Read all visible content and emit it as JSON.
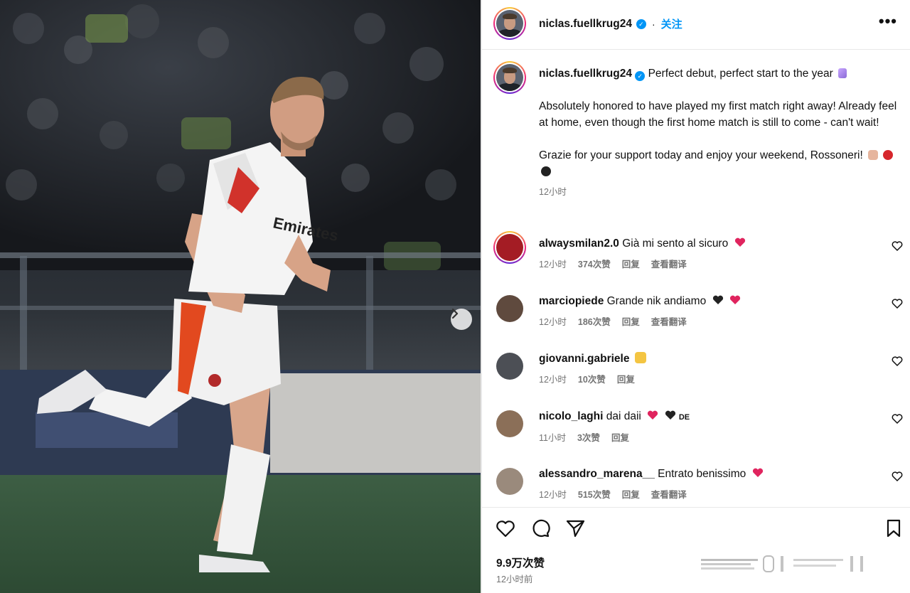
{
  "header": {
    "username": "niclas.fuellkrug24",
    "follow_label": "关注",
    "more_label": "•••"
  },
  "caption": {
    "username": "niclas.fuellkrug24",
    "line1": "Perfect debut, perfect start to the year",
    "para1": "Absolutely honored to have played my first match right away! Already feel at home, even though the first home match is still to come - can't wait!",
    "para2": "Grazie for your support today and enjoy your weekend, Rossoneri!",
    "time": "12小时"
  },
  "photo": {
    "jersey_sponsor": "Emirates"
  },
  "comments": [
    {
      "username": "alwaysmilan2.0",
      "text": "Già mi sento al sicuro",
      "time": "12小时",
      "likes": "374次赞",
      "reply": "回复",
      "translate": "查看翻译"
    },
    {
      "username": "marciopiede",
      "text": "Grande nik andiamo",
      "time": "12小时",
      "likes": "186次赞",
      "reply": "回复",
      "translate": "查看翻译"
    },
    {
      "username": "giovanni.gabriele",
      "text": "",
      "time": "12小时",
      "likes": "10次赞",
      "reply": "回复",
      "translate": ""
    },
    {
      "username": "nicolo_laghi",
      "text": "dai daii",
      "suffix": "DE",
      "time": "11小时",
      "likes": "3次赞",
      "reply": "回复",
      "translate": ""
    },
    {
      "username": "alessandro_marena__",
      "text": "Entrato benissimo",
      "time": "12小时",
      "likes": "515次赞",
      "reply": "回复",
      "translate": "查看翻译"
    }
  ],
  "footer": {
    "likes": "9.9万次赞",
    "time": "12小时前"
  },
  "colors": {
    "accent": "#0095f6",
    "heart_red": "#e0245e",
    "meta_gray": "#737373"
  },
  "icons": [
    "verified-icon",
    "more-icon",
    "heart-icon",
    "comment-icon",
    "share-icon",
    "bookmark-icon",
    "next-arrow-icon"
  ]
}
